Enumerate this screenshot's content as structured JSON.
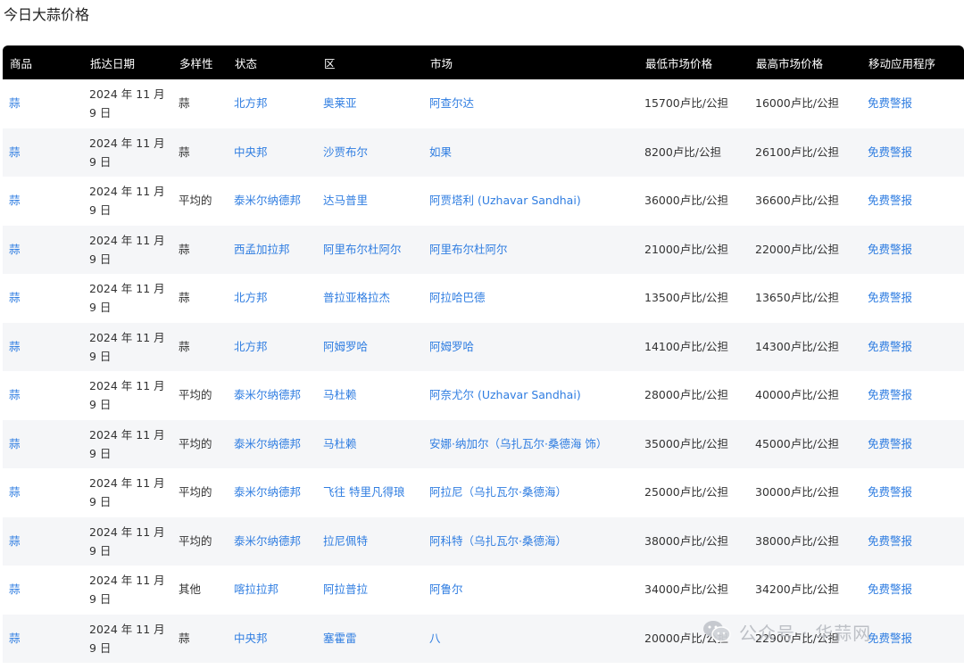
{
  "page": {
    "title": "今日大蒜价格"
  },
  "table": {
    "headers": [
      "商品",
      "抵达日期",
      "多样性",
      "状态",
      "区",
      "市场",
      "最低市场价格",
      "最高市场价格",
      "移动应用程序"
    ],
    "rows": [
      {
        "commodity": "蒜",
        "date_line1": "2024 年 11 月",
        "date_line2": "9 日",
        "variety": "蒜",
        "state": "北方邦",
        "district": "奥莱亚",
        "market": "阿查尔达",
        "min": "15700卢比/公担",
        "max": "16000卢比/公担",
        "app": "免费警报"
      },
      {
        "commodity": "蒜",
        "date_line1": "2024 年 11 月",
        "date_line2": "9 日",
        "variety": "蒜",
        "state": "中央邦",
        "district": "沙贾布尔",
        "market": "如果",
        "min": "8200卢比/公担",
        "max": "26100卢比/公担",
        "app": "免费警报"
      },
      {
        "commodity": "蒜",
        "date_line1": "2024 年 11 月",
        "date_line2": "9 日",
        "variety": "平均的",
        "state": "泰米尔纳德邦",
        "district": "达马普里",
        "market": "阿贾塔利 (Uzhavar Sandhai)",
        "min": "36000卢比/公担",
        "max": "36600卢比/公担",
        "app": "免费警报"
      },
      {
        "commodity": "蒜",
        "date_line1": "2024 年 11 月",
        "date_line2": "9 日",
        "variety": "蒜",
        "state": "西孟加拉邦",
        "district": "阿里布尔杜阿尔",
        "market": "阿里布尔杜阿尔",
        "min": "21000卢比/公担",
        "max": "22000卢比/公担",
        "app": "免费警报"
      },
      {
        "commodity": "蒜",
        "date_line1": "2024 年 11 月",
        "date_line2": "9 日",
        "variety": "蒜",
        "state": "北方邦",
        "district": "普拉亚格拉杰",
        "market": "阿拉哈巴德",
        "min": "13500卢比/公担",
        "max": "13650卢比/公担",
        "app": "免费警报"
      },
      {
        "commodity": "蒜",
        "date_line1": "2024 年 11 月",
        "date_line2": "9 日",
        "variety": "蒜",
        "state": "北方邦",
        "district": "阿姆罗哈",
        "market": "阿姆罗哈",
        "min": "14100卢比/公担",
        "max": "14300卢比/公担",
        "app": "免费警报"
      },
      {
        "commodity": "蒜",
        "date_line1": "2024 年 11 月",
        "date_line2": "9 日",
        "variety": "平均的",
        "state": "泰米尔纳德邦",
        "district": "马杜赖",
        "market": "阿奈尤尔 (Uzhavar Sandhai)",
        "min": "28000卢比/公担",
        "max": "40000卢比/公担",
        "app": "免费警报"
      },
      {
        "commodity": "蒜",
        "date_line1": "2024 年 11 月",
        "date_line2": "9 日",
        "variety": "平均的",
        "state": "泰米尔纳德邦",
        "district": "马杜赖",
        "market": "安娜·纳加尔（乌扎瓦尔·桑德海 饰）",
        "min": "35000卢比/公担",
        "max": "45000卢比/公担",
        "app": "免费警报"
      },
      {
        "commodity": "蒜",
        "date_line1": "2024 年 11 月",
        "date_line2": "9 日",
        "variety": "平均的",
        "state": "泰米尔纳德邦",
        "district": "飞往 特里凡得琅",
        "market": "阿拉尼（乌扎瓦尔·桑德海）",
        "min": "25000卢比/公担",
        "max": "30000卢比/公担",
        "app": "免费警报"
      },
      {
        "commodity": "蒜",
        "date_line1": "2024 年 11 月",
        "date_line2": "9 日",
        "variety": "平均的",
        "state": "泰米尔纳德邦",
        "district": "拉尼佩特",
        "market": "阿科特（乌扎瓦尔·桑德海）",
        "min": "38000卢比/公担",
        "max": "38000卢比/公担",
        "app": "免费警报"
      },
      {
        "commodity": "蒜",
        "date_line1": "2024 年 11 月",
        "date_line2": "9 日",
        "variety": "其他",
        "state": "喀拉拉邦",
        "district": "阿拉普拉",
        "market": "阿鲁尔",
        "min": "34000卢比/公担",
        "max": "34200卢比/公担",
        "app": "免费警报"
      },
      {
        "commodity": "蒜",
        "date_line1": "2024 年 11 月",
        "date_line2": "9 日",
        "variety": "蒜",
        "state": "中央邦",
        "district": "塞霍雷",
        "market": "八",
        "min": "20000卢比/公担",
        "max": "22900卢比/公担",
        "app": "免费警报"
      }
    ]
  },
  "watermark": {
    "text": "公众号 · 华蒜网",
    "icon": "wechat-icon"
  },
  "colors": {
    "header_bg": "#000000",
    "link": "#2f7de1",
    "stripe": "#f5f6f8"
  }
}
